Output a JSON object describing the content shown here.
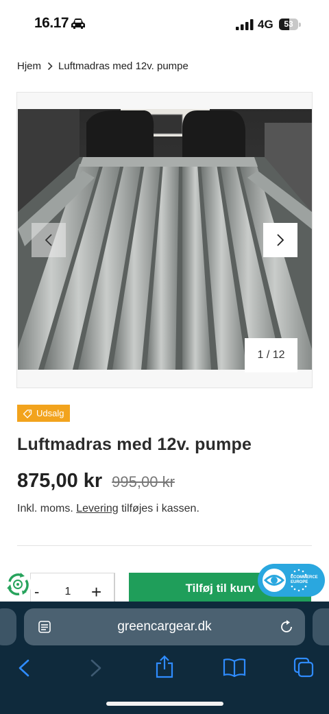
{
  "status_bar": {
    "time": "16.17",
    "network": "4G",
    "battery_level": 53,
    "battery_text": "53"
  },
  "breadcrumb": {
    "home": "Hjem",
    "current": "Luftmadras med 12v. pumpe"
  },
  "gallery": {
    "counter": "1 / 12"
  },
  "product": {
    "sale_badge": "Udsalg",
    "title": "Luftmadras med 12v. pumpe",
    "price": "875,00 kr",
    "old_price": "995,00 kr",
    "tax_prefix": "Inkl. moms.",
    "shipping_link": "Levering",
    "tax_suffix": "tilføjes i kassen."
  },
  "cart": {
    "minus": "-",
    "quantity": "1",
    "plus": "+",
    "add_label": "Tilføj til kurv"
  },
  "trust_badge": {
    "line1": "ECOMMERCE",
    "line2": "EUROPE"
  },
  "browser": {
    "url": "greencargear.dk"
  },
  "colors": {
    "accent_green": "#1f9e5a",
    "sale_orange": "#f2a31d",
    "safari_bar": "#0f2a3c",
    "link_blue": "#2f8cff"
  }
}
